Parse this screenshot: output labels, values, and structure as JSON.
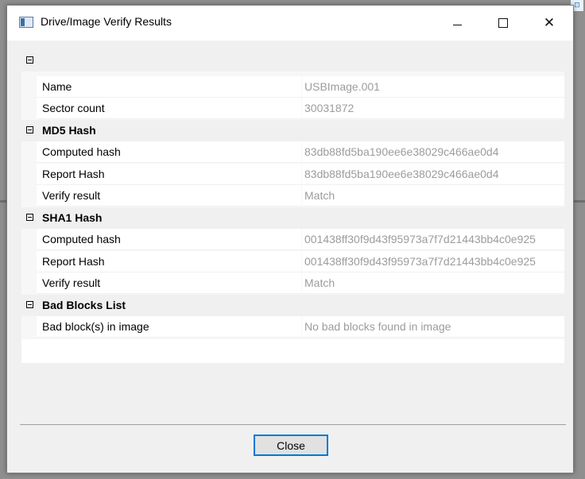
{
  "window": {
    "title": "Drive/Image Verify Results"
  },
  "grid": {
    "rows": [
      {
        "kind": "category",
        "label": ""
      },
      {
        "kind": "property",
        "name": "Name",
        "value": "USBImage.001"
      },
      {
        "kind": "property",
        "name": "Sector count",
        "value": "30031872"
      },
      {
        "kind": "category",
        "label": "MD5 Hash"
      },
      {
        "kind": "property",
        "name": "Computed hash",
        "value": "83db88fd5ba190ee6e38029c466ae0d4"
      },
      {
        "kind": "property",
        "name": "Report Hash",
        "value": "83db88fd5ba190ee6e38029c466ae0d4"
      },
      {
        "kind": "property",
        "name": "Verify result",
        "value": "Match"
      },
      {
        "kind": "category",
        "label": "SHA1 Hash"
      },
      {
        "kind": "property",
        "name": "Computed hash",
        "value": "001438ff30f9d43f95973a7f7d21443bb4c0e925"
      },
      {
        "kind": "property",
        "name": "Report Hash",
        "value": "001438ff30f9d43f95973a7f7d21443bb4c0e925"
      },
      {
        "kind": "property",
        "name": "Verify result",
        "value": "Match"
      },
      {
        "kind": "category",
        "label": "Bad Blocks List"
      },
      {
        "kind": "property",
        "name": "Bad block(s) in image",
        "value": "No bad blocks found in image"
      }
    ]
  },
  "footer": {
    "close_label": "Close"
  },
  "colors": {
    "accent": "#0078d7",
    "value_text": "#9c9c9c",
    "dialog_bg": "#f0f0f0"
  },
  "icons": [
    "app-window-icon",
    "minimize-icon",
    "maximize-icon",
    "close-icon",
    "collapse-icon"
  ]
}
